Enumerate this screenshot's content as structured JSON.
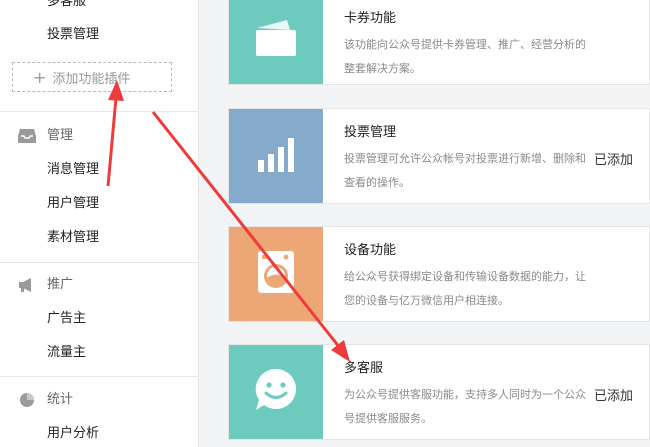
{
  "sidebar": {
    "items_top": [
      "多客服",
      "投票管理"
    ],
    "add_plugin_label": "添加功能插件",
    "sections": [
      {
        "title": "管理",
        "icon": "inbox-icon",
        "items": [
          "消息管理",
          "用户管理",
          "素材管理"
        ]
      },
      {
        "title": "推广",
        "icon": "megaphone-icon",
        "items": [
          "广告主",
          "流量主"
        ]
      },
      {
        "title": "统计",
        "icon": "pie-chart-icon",
        "items": [
          "用户分析"
        ]
      }
    ]
  },
  "plugins": [
    {
      "title": "卡券功能",
      "desc": "该功能向公众号提供卡券管理、推广、经营分析的整套解决方案。",
      "status": "",
      "color": "#6ccbbe",
      "icon": "card-icon"
    },
    {
      "title": "投票管理",
      "desc": "投票管理可允许公众帐号对投票进行新增、删除和查看的操作。",
      "status": "已添加",
      "color": "#86aacb",
      "icon": "bar-chart-icon"
    },
    {
      "title": "设备功能",
      "desc": "给公众号获得绑定设备和传输设备数据的能力，让您的设备与亿万微信用户相连接。",
      "status": "",
      "color": "#eda777",
      "icon": "washing-machine-icon"
    },
    {
      "title": "多客服",
      "desc": "为公众号提供客服功能，支持多人同时为一个公众号提供客服服务。",
      "status": "已添加",
      "color": "#6ccbbe",
      "icon": "smile-chat-icon"
    }
  ],
  "annotation_color": "#ee3b3b"
}
